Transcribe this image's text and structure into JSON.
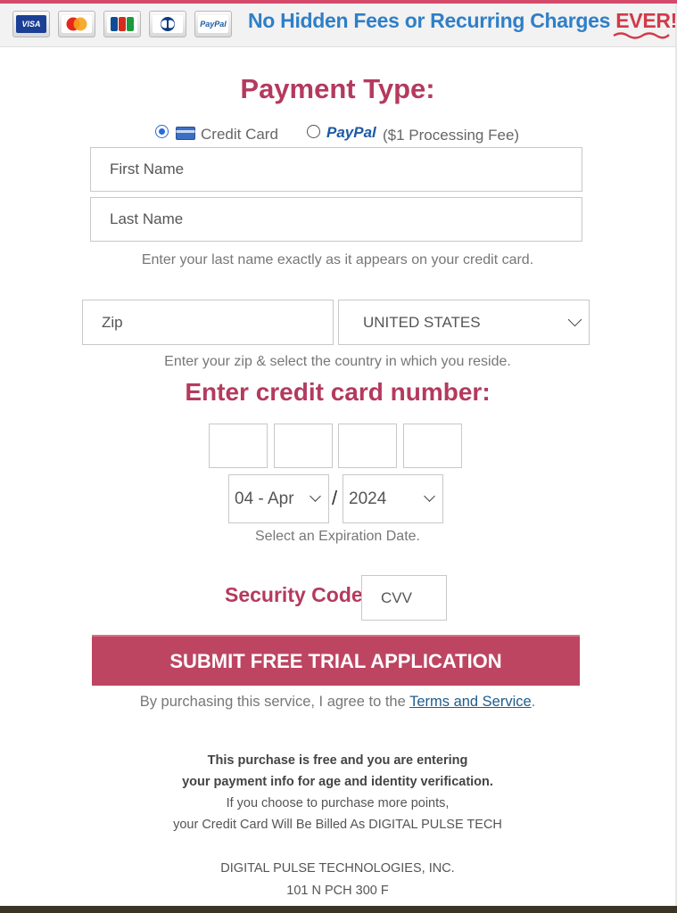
{
  "banner": {
    "cards": [
      "VISA",
      "MasterCard",
      "JCB",
      "Diners Club",
      "PayPal"
    ],
    "text": "No Hidden Fees or Recurring Charges",
    "emphasis": "EVER!"
  },
  "payment_type": {
    "title": "Payment Type:",
    "options": [
      {
        "label": "Credit Card",
        "selected": true
      },
      {
        "label": "PayPal",
        "suffix": "($1 Processing Fee)",
        "selected": false
      }
    ]
  },
  "form": {
    "first_name_placeholder": "First Name",
    "last_name_placeholder": "Last Name",
    "last_name_hint": "Enter your last name exactly as it appears on your credit card.",
    "zip_placeholder": "Zip",
    "country": "UNITED STATES",
    "zip_hint": "Enter your zip & select the country in which you reside.",
    "card_title": "Enter credit card number:",
    "exp_month": "04 - Apr",
    "exp_separator": "/",
    "exp_year": "2024",
    "exp_hint": "Select an Expiration Date.",
    "security_label": "Security Code:",
    "cvv_placeholder": "CVV"
  },
  "submit_label": "SUBMIT FREE TRIAL APPLICATION",
  "terms": {
    "prefix": "By purchasing this service, I agree to the ",
    "link": "Terms and Service",
    "suffix": "."
  },
  "fine_print": {
    "line1": "This purchase is free and you are entering",
    "line2": "your payment info for age and identity verification.",
    "line3": "If you choose to purchase more points,",
    "line4": "your Credit Card Will Be Billed As DIGITAL PULSE TECH",
    "company": "DIGITAL PULSE TECHNOLOGIES, INC.",
    "address": "101 N PCH 300 F"
  },
  "colors": {
    "accent": "#be4562",
    "title": "#b43a5e",
    "banner_text": "#2f7fc8",
    "link": "#1f5c8b"
  }
}
